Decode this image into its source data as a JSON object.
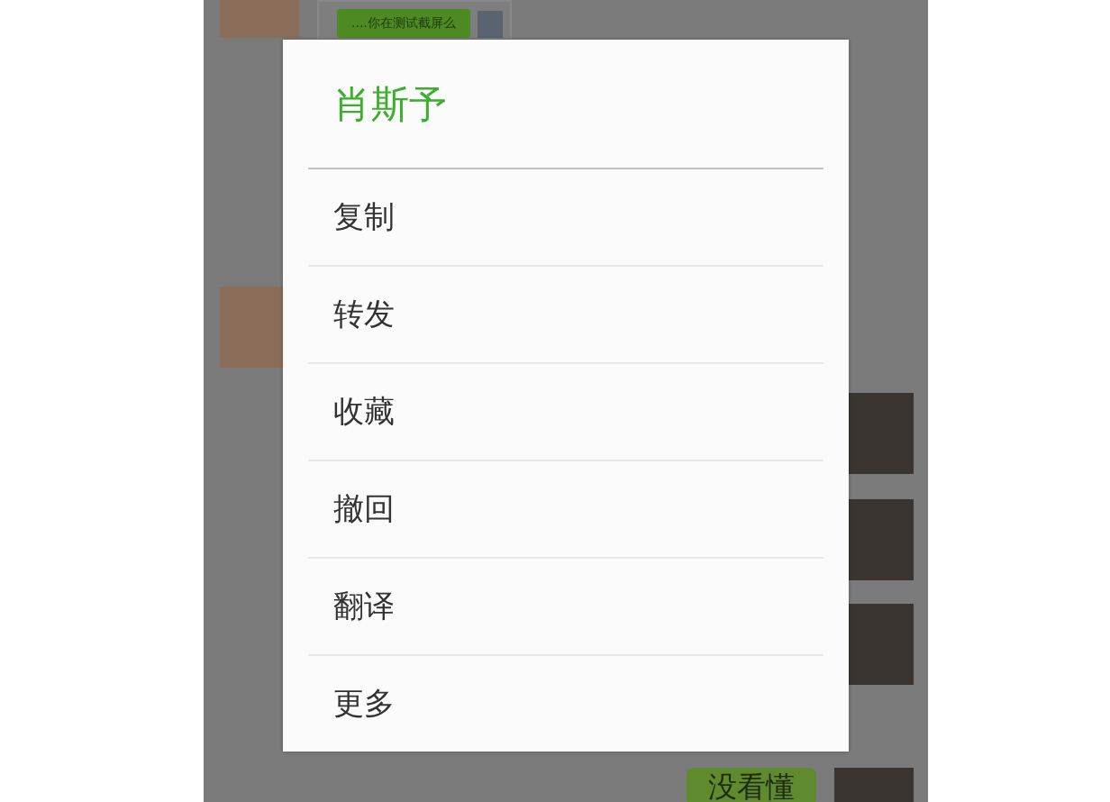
{
  "chat": {
    "messages": [
      {
        "outgoing": false,
        "kind": "screenshot",
        "text": "....你在测试截屏么"
      },
      {
        "outgoing": false,
        "kind": "covered"
      },
      {
        "outgoing": true,
        "kind": "covered"
      },
      {
        "outgoing": true,
        "kind": "covered"
      },
      {
        "outgoing": true,
        "kind": "covered"
      },
      {
        "outgoing": true,
        "kind": "text",
        "text": "没看懂"
      }
    ]
  },
  "dialog": {
    "title": "肖斯予",
    "items": [
      "复制",
      "转发",
      "收藏",
      "撤回",
      "翻译",
      "更多"
    ]
  }
}
